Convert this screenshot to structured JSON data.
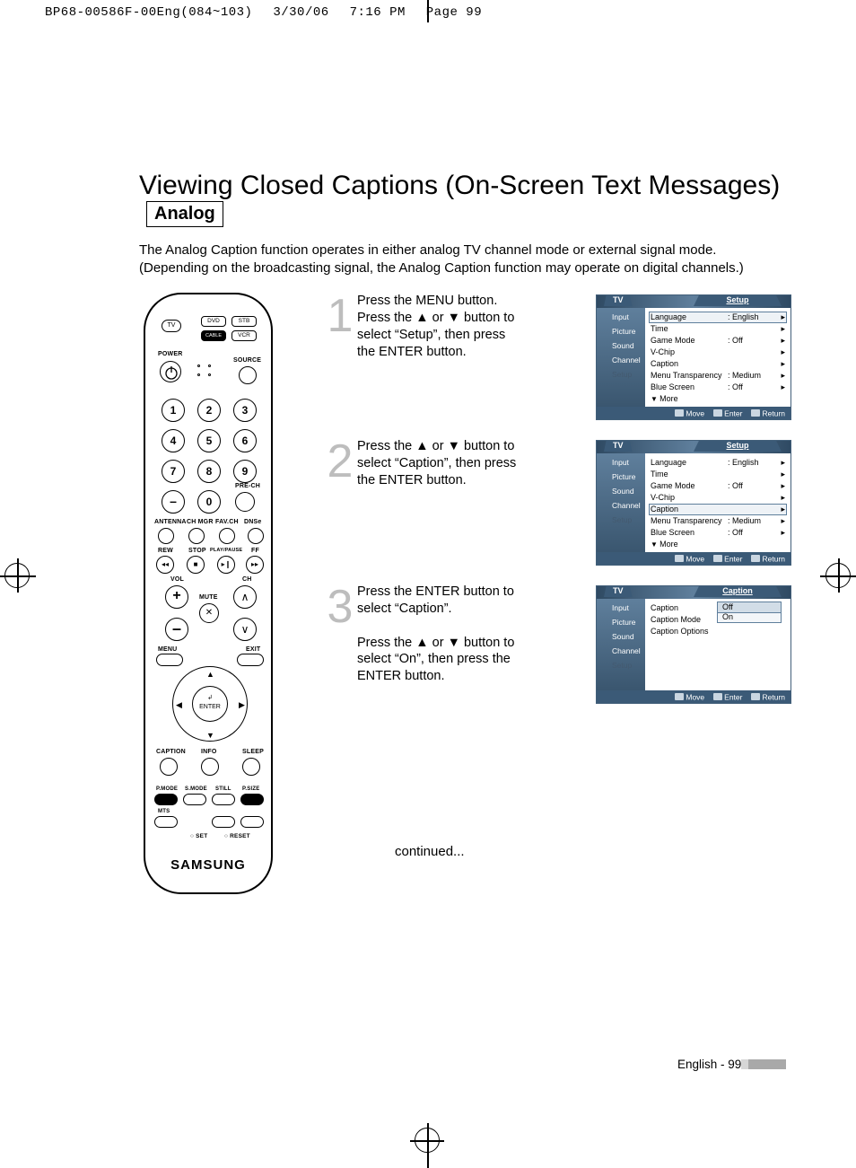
{
  "print_header": {
    "file": "BP68-00586F-00Eng(084~103)",
    "date": "3/30/06",
    "time": "7:16 PM",
    "page": "Page 99"
  },
  "title": "Viewing Closed Captions (On-Screen Text Messages)",
  "badge": "Analog",
  "intro": "The Analog Caption function operates in either analog TV channel mode or external signal mode. (Depending on the broadcasting signal, the Analog Caption function may operate on digital channels.)",
  "steps": [
    {
      "num": "1",
      "text": "Press the MENU button.\nPress the ▲ or ▼ button to select “Setup”, then press the ENTER button."
    },
    {
      "num": "2",
      "text": "Press the ▲ or ▼ button to select “Caption”, then press the ENTER button."
    },
    {
      "num": "3",
      "text": "Press the ENTER button to select “Caption”.\n\nPress the ▲ or ▼ button to select “On”, then press the ENTER button."
    }
  ],
  "continued": "continued...",
  "osd": {
    "tv": "TV",
    "title_setup": "Setup",
    "title_caption": "Caption",
    "sidebar": [
      "Input",
      "Picture",
      "Sound",
      "Channel",
      "Setup"
    ],
    "menu1": [
      {
        "label": "Language",
        "value": ": English"
      },
      {
        "label": "Time",
        "value": ""
      },
      {
        "label": "Game Mode",
        "value": ": Off"
      },
      {
        "label": "V-Chip",
        "value": ""
      },
      {
        "label": "Caption",
        "value": ""
      },
      {
        "label": "Menu Transparency",
        "value": ": Medium"
      },
      {
        "label": "Blue Screen",
        "value": ": Off"
      }
    ],
    "more": "More",
    "menu3": [
      {
        "label": "Caption",
        "value": ""
      },
      {
        "label": "Caption Mode",
        "value": ""
      },
      {
        "label": "Caption Options",
        "value": ""
      }
    ],
    "options": [
      "Off",
      "On"
    ],
    "footer": {
      "move": "Move",
      "enter": "Enter",
      "return": "Return"
    }
  },
  "remote": {
    "top_row": {
      "tv": "TV",
      "dvd": "DVD",
      "stb": "STB",
      "cable": "CABLE",
      "vcr": "VCR"
    },
    "power": "POWER",
    "source": "SOURCE",
    "pre_ch": "PRE-CH",
    "antenna": "ANTENNA",
    "chmgr": "CH MGR",
    "favch": "FAV.CH",
    "dnse": "DNSe",
    "rew": "REW",
    "stop": "STOP",
    "play": "PLAY/PAUSE",
    "ff": "FF",
    "vol": "VOL",
    "ch": "CH",
    "mute": "MUTE",
    "menu": "MENU",
    "exit": "EXIT",
    "enter": "ENTER",
    "caption": "CAPTION",
    "info": "INFO",
    "sleep": "SLEEP",
    "pmode": "P.MODE",
    "smode": "S.MODE",
    "still": "STILL",
    "psize": "P.SIZE",
    "mts": "MTS",
    "set": "SET",
    "reset": "RESET",
    "brand": "SAMSUNG"
  },
  "footer": {
    "text": "English - 99"
  }
}
